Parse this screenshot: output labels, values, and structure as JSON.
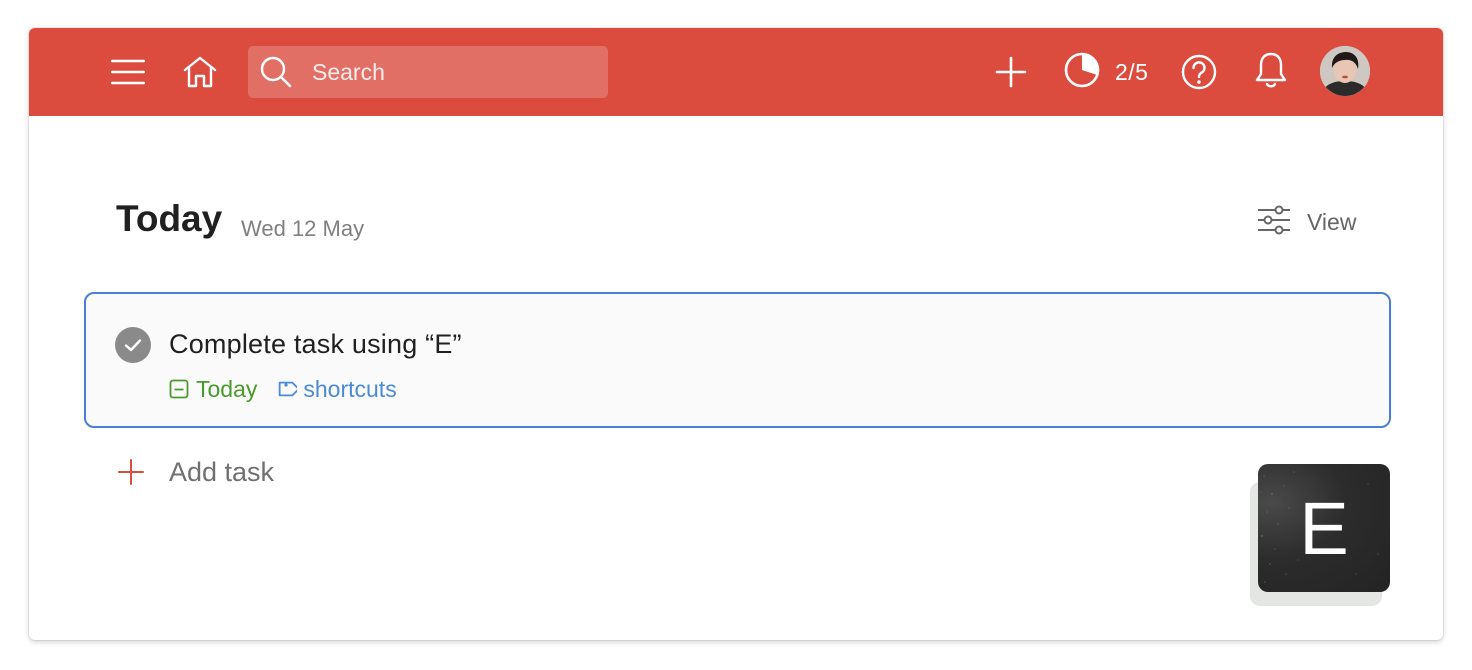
{
  "topbar": {
    "color": "#db4c3f",
    "menu_icon": "hamburger-menu-icon",
    "home_icon": "home-icon",
    "search": {
      "placeholder": "Search",
      "icon": "search-icon"
    },
    "add_icon": "plus-icon",
    "karma": {
      "icon": "productivity-pie-icon",
      "progress_text": "2/5"
    },
    "help_icon": "help-icon",
    "notifications_icon": "bell-icon",
    "avatar_icon": "user-avatar"
  },
  "main": {
    "title": "Today",
    "date": "Wed 12 May",
    "view": {
      "icon": "sliders-icon",
      "label": "View"
    }
  },
  "tasks": [
    {
      "title": "Complete task using “E”",
      "completed": true,
      "due": {
        "label": "Today",
        "color": "#4a9a2b",
        "icon": "calendar-icon"
      },
      "label": {
        "name": "shortcuts",
        "color": "#4b8ad6",
        "icon": "tag-icon"
      }
    }
  ],
  "add_task": {
    "label": "Add task",
    "icon": "plus-icon"
  },
  "key_overlay": {
    "letter": "E"
  }
}
